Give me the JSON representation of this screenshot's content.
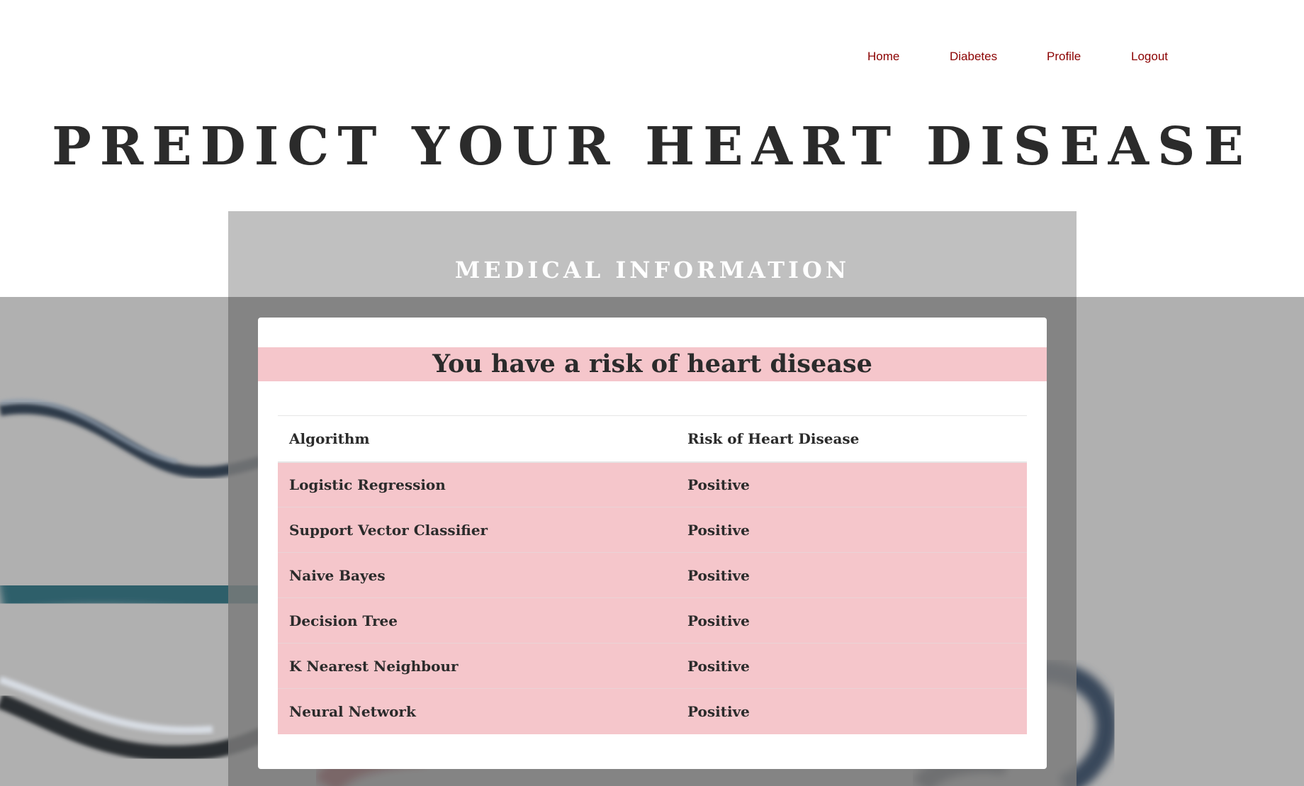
{
  "nav": {
    "items": [
      {
        "label": "Home"
      },
      {
        "label": "Diabetes"
      },
      {
        "label": "Profile"
      },
      {
        "label": "Logout"
      }
    ]
  },
  "page": {
    "title": "PREDICT YOUR HEART DISEASE",
    "panel_heading": "MEDICAL INFORMATION",
    "result_banner": "You have a risk of heart disease"
  },
  "table": {
    "headers": [
      "Algorithm",
      "Risk of Heart Disease"
    ],
    "rows": [
      {
        "algorithm": "Logistic Regression",
        "risk": "Positive"
      },
      {
        "algorithm": "Support Vector Classifier",
        "risk": "Positive"
      },
      {
        "algorithm": "Naive Bayes",
        "risk": "Positive"
      },
      {
        "algorithm": "Decision Tree",
        "risk": "Positive"
      },
      {
        "algorithm": "K Nearest Neighbour",
        "risk": "Positive"
      },
      {
        "algorithm": "Neural Network",
        "risk": "Positive"
      }
    ]
  },
  "colors": {
    "nav_link": "#8b0000",
    "result_highlight": "#f5c6cb",
    "title_text": "#2b2b2b"
  }
}
